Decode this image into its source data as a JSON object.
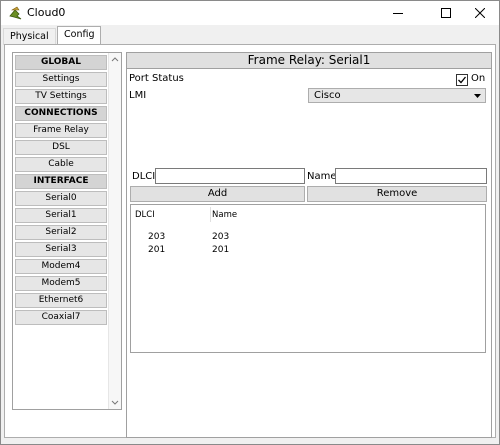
{
  "window": {
    "title": "Cloud0"
  },
  "tabs": [
    {
      "label": "Physical"
    },
    {
      "label": "Config"
    }
  ],
  "sidebar": {
    "items": [
      {
        "label": "GLOBAL",
        "header": true
      },
      {
        "label": "Settings"
      },
      {
        "label": "TV Settings"
      },
      {
        "label": "CONNECTIONS",
        "header": true
      },
      {
        "label": "Frame Relay"
      },
      {
        "label": "DSL"
      },
      {
        "label": "Cable"
      },
      {
        "label": "INTERFACE",
        "header": true
      },
      {
        "label": "Serial0"
      },
      {
        "label": "Serial1"
      },
      {
        "label": "Serial2"
      },
      {
        "label": "Serial3"
      },
      {
        "label": "Modem4"
      },
      {
        "label": "Modem5"
      },
      {
        "label": "Ethernet6"
      },
      {
        "label": "Coaxial7"
      }
    ]
  },
  "config": {
    "title": "Frame Relay: Serial1",
    "port_status_label": "Port Status",
    "port_status_on_label": "On",
    "port_status_checked": true,
    "lmi_label": "LMI",
    "lmi_value": "Cisco",
    "dlci_label": "DLCI",
    "dlci_value": "",
    "name_label": "Name",
    "name_value": "",
    "add_label": "Add",
    "remove_label": "Remove",
    "table": {
      "headers": [
        "DLCI",
        "Name"
      ],
      "rows": [
        {
          "dlci": "203",
          "name": "203"
        },
        {
          "dlci": "201",
          "name": "201"
        }
      ]
    }
  }
}
